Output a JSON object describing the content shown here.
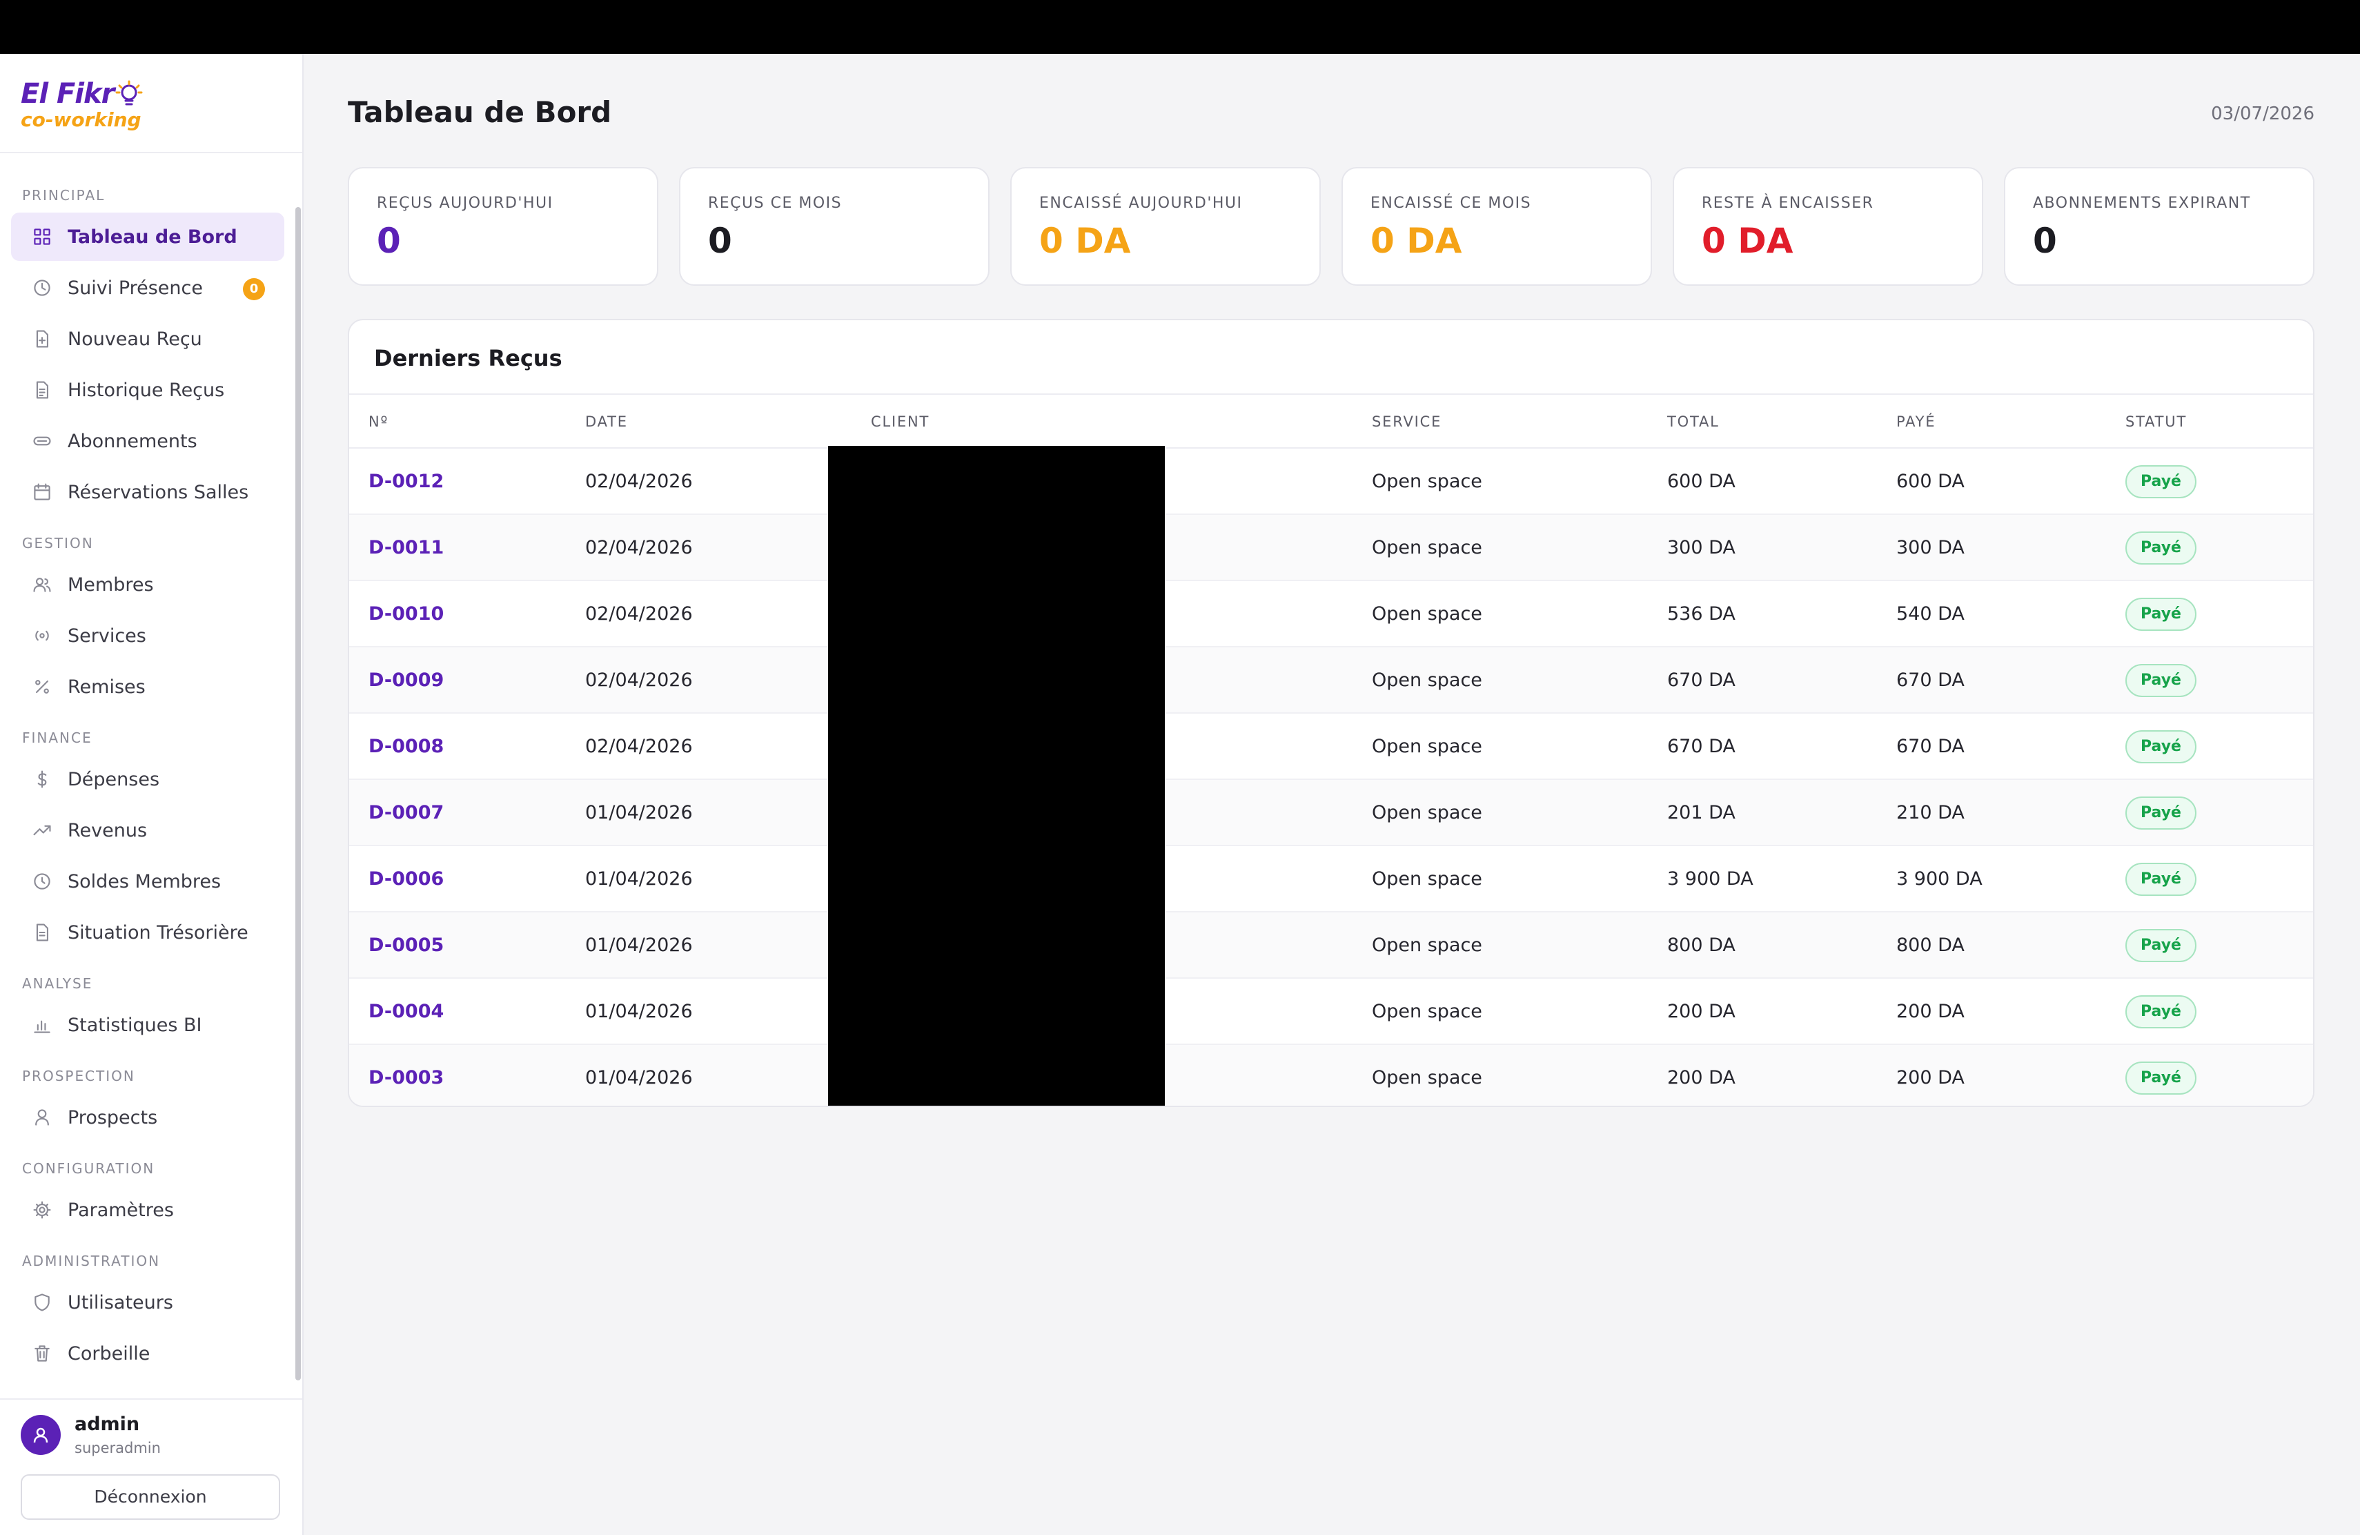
{
  "app": {
    "logo_line1": "El Fikr",
    "logo_line2": "co-working",
    "brand_color": "#5b21b6",
    "accent_color": "#f5a316"
  },
  "sidebar": {
    "sections": [
      {
        "title": "PRINCIPAL",
        "items": [
          {
            "label": "Tableau de Bord",
            "icon": "grid-icon",
            "active": true
          },
          {
            "label": "Suivi Présence",
            "icon": "clock-icon",
            "badge": "0"
          },
          {
            "label": "Nouveau Reçu",
            "icon": "file-plus-icon"
          },
          {
            "label": "Historique Reçus",
            "icon": "file-text-icon"
          },
          {
            "label": "Abonnements",
            "icon": "card-icon"
          },
          {
            "label": "Réservations Salles",
            "icon": "calendar-icon"
          }
        ]
      },
      {
        "title": "GESTION",
        "items": [
          {
            "label": "Membres",
            "icon": "users-icon"
          },
          {
            "label": "Services",
            "icon": "radio-icon"
          },
          {
            "label": "Remises",
            "icon": "percent-icon"
          }
        ]
      },
      {
        "title": "FINANCE",
        "items": [
          {
            "label": "Dépenses",
            "icon": "dollar-icon"
          },
          {
            "label": "Revenus",
            "icon": "trending-up-icon"
          },
          {
            "label": "Soldes Membres",
            "icon": "circle-clock-icon"
          },
          {
            "label": "Situation Trésorière",
            "icon": "document-icon"
          }
        ]
      },
      {
        "title": "ANALYSE",
        "items": [
          {
            "label": "Statistiques BI",
            "icon": "bar-chart-icon"
          }
        ]
      },
      {
        "title": "PROSPECTION",
        "items": [
          {
            "label": "Prospects",
            "icon": "user-icon"
          }
        ]
      },
      {
        "title": "CONFIGURATION",
        "items": [
          {
            "label": "Paramètres",
            "icon": "gear-icon"
          }
        ]
      },
      {
        "title": "ADMINISTRATION",
        "items": [
          {
            "label": "Utilisateurs",
            "icon": "shield-icon"
          },
          {
            "label": "Corbeille",
            "icon": "trash-icon"
          }
        ]
      }
    ],
    "user": {
      "name": "admin",
      "role": "superadmin",
      "logout_label": "Déconnexion"
    }
  },
  "header": {
    "title": "Tableau de Bord",
    "date": "03/07/2026"
  },
  "cards": [
    {
      "label": "REÇUS AUJOURD'HUI",
      "value": "0",
      "color": "#5b21b6"
    },
    {
      "label": "REÇUS CE MOIS",
      "value": "0",
      "color": "#1c1c22"
    },
    {
      "label": "ENCAISSÉ AUJOURD'HUI",
      "value": "0 DA",
      "color": "#f5a316"
    },
    {
      "label": "ENCAISSÉ CE MOIS",
      "value": "0 DA",
      "color": "#f5a316"
    },
    {
      "label": "RESTE À ENCAISSER",
      "value": "0 DA",
      "color": "#e11d2a"
    },
    {
      "label": "ABONNEMENTS EXPIRANT",
      "value": "0",
      "color": "#1c1c22"
    }
  ],
  "table": {
    "title": "Derniers Reçus",
    "columns": [
      "Nº",
      "DATE",
      "CLIENT",
      "SERVICE",
      "TOTAL",
      "PAYÉ",
      "STATUT"
    ],
    "rows": [
      {
        "num": "D-0012",
        "date": "02/04/2026",
        "service": "Open space",
        "total": "600 DA",
        "paid": "600 DA",
        "status": "Payé"
      },
      {
        "num": "D-0011",
        "date": "02/04/2026",
        "service": "Open space",
        "total": "300 DA",
        "paid": "300 DA",
        "status": "Payé"
      },
      {
        "num": "D-0010",
        "date": "02/04/2026",
        "service": "Open space",
        "total": "536 DA",
        "paid": "540 DA",
        "status": "Payé"
      },
      {
        "num": "D-0009",
        "date": "02/04/2026",
        "service": "Open space",
        "total": "670 DA",
        "paid": "670 DA",
        "status": "Payé"
      },
      {
        "num": "D-0008",
        "date": "02/04/2026",
        "service": "Open space",
        "total": "670 DA",
        "paid": "670 DA",
        "status": "Payé"
      },
      {
        "num": "D-0007",
        "date": "01/04/2026",
        "service": "Open space",
        "total": "201 DA",
        "paid": "210 DA",
        "status": "Payé"
      },
      {
        "num": "D-0006",
        "date": "01/04/2026",
        "service": "Open space",
        "total": "3 900 DA",
        "paid": "3 900 DA",
        "status": "Payé"
      },
      {
        "num": "D-0005",
        "date": "01/04/2026",
        "service": "Open space",
        "total": "800 DA",
        "paid": "800 DA",
        "status": "Payé"
      },
      {
        "num": "D-0004",
        "date": "01/04/2026",
        "service": "Open space",
        "total": "200 DA",
        "paid": "200 DA",
        "status": "Payé"
      },
      {
        "num": "D-0003",
        "date": "01/04/2026",
        "service": "Open space",
        "total": "200 DA",
        "paid": "200 DA",
        "status": "Payé"
      }
    ]
  }
}
